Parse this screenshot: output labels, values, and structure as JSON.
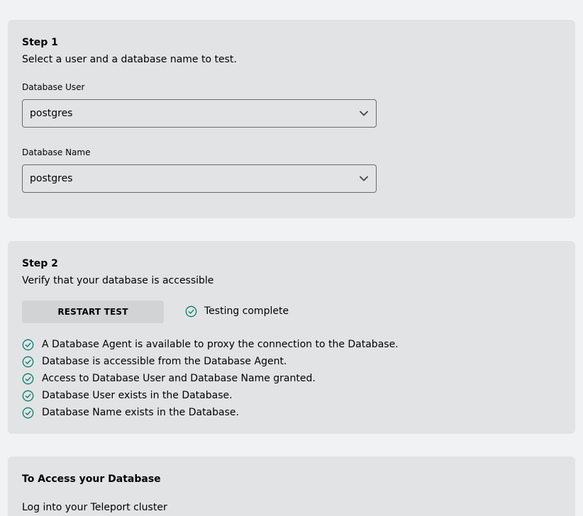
{
  "step1": {
    "title": "Step 1",
    "description": "Select a user and a database name to test.",
    "user_label": "Database User",
    "user_value": "postgres",
    "name_label": "Database Name",
    "name_value": "postgres"
  },
  "step2": {
    "title": "Step 2",
    "description": "Verify that your database is accessible",
    "restart_button": "RESTART TEST",
    "status": "Testing complete",
    "checks": [
      "A Database Agent is available to proxy the connection to the Database.",
      "Database is accessible from the Database Agent.",
      "Access to Database User and Database Name granted.",
      "Database User exists in the Database.",
      "Database Name exists in the Database."
    ]
  },
  "access": {
    "title": "To Access your Database",
    "login_text": "Log into your Teleport cluster"
  },
  "colors": {
    "success": "#007d6b",
    "card": "#e2e3e5",
    "page": "#f1f2f4"
  },
  "icons": {
    "select_chevron": "chevron-down-icon",
    "success": "check-circle-icon"
  }
}
